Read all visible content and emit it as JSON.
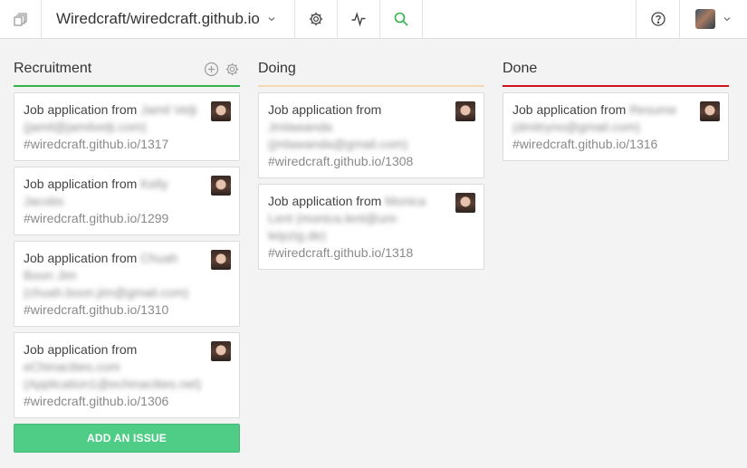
{
  "topbar": {
    "repo_name": "Wiredcraft/wiredcraft.github.io",
    "icons": {
      "logo": "stack-logo-icon",
      "settings": "gear-icon",
      "activity": "activity-pulse-icon",
      "search": "search-icon",
      "help": "help-circle-icon",
      "dropdown": "chevron-down-icon"
    }
  },
  "colors": {
    "recruitment": "#2fb34a",
    "doing": "#f8d7b4",
    "done": "#d0121a",
    "add_button": "#4fcc85",
    "search_accent": "#2fb34a"
  },
  "columns": [
    {
      "title": "Recruitment",
      "cards": [
        {
          "prefix": "Job application from",
          "blurred": "Jamil Velji (jamil@jamilvelji.com)",
          "ref": "#wiredcraft.github.io/1317"
        },
        {
          "prefix": "Job application from",
          "blurred": "Kelly Jacobs",
          "ref": "#wiredcraft.github.io/1299"
        },
        {
          "prefix": "Job application from",
          "blurred": "Chuah Boon Jim (chuah.boon.jim@gmail.com)",
          "ref": "#wiredcraft.github.io/1310"
        },
        {
          "prefix": "Job application from",
          "blurred": "eChinacities.com (Application1@echinacities.net)",
          "ref": "#wiredcraft.github.io/1306"
        }
      ],
      "add_label": "ADD AN ISSUE"
    },
    {
      "title": "Doing",
      "cards": [
        {
          "prefix": "Job application from",
          "blurred": "Jmlawanda (jmlawanda@gmail.com)",
          "ref": "#wiredcraft.github.io/1308"
        },
        {
          "prefix": "Job application from",
          "blurred": "Monica Lent (monica.lent@uni-leipzig.de)",
          "ref": "#wiredcraft.github.io/1318"
        }
      ]
    },
    {
      "title": "Done",
      "cards": [
        {
          "prefix": "Job application from",
          "blurred": "Resume (dmitryno@gmail.com)",
          "ref": "#wiredcraft.github.io/1316"
        }
      ]
    }
  ]
}
